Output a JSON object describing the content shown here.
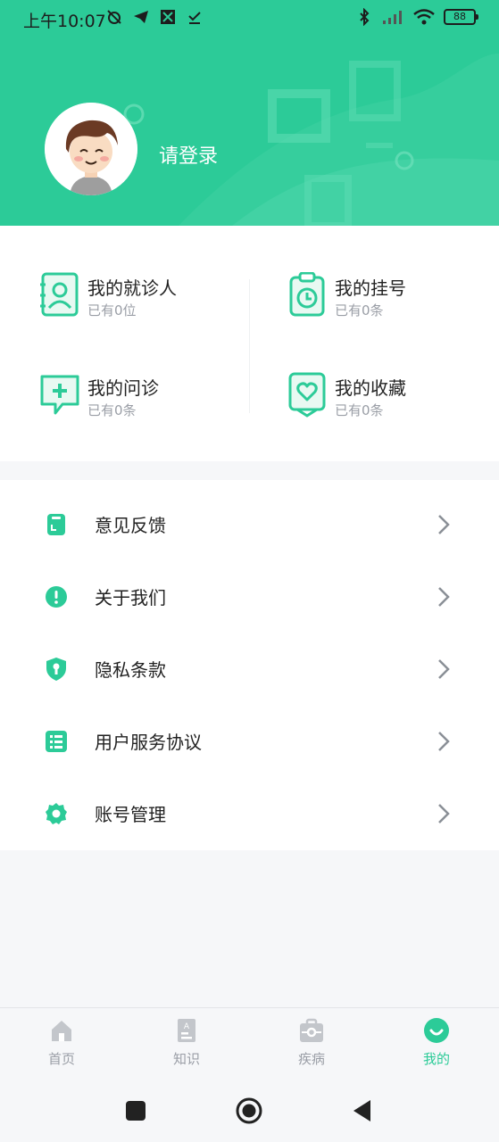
{
  "status_bar": {
    "time": "上午10:07",
    "battery": "88"
  },
  "profile": {
    "login_prompt": "请登录"
  },
  "quick_links": [
    {
      "title": "我的就诊人",
      "subtitle": "已有0位",
      "icon": "contact-card-icon"
    },
    {
      "title": "我的挂号",
      "subtitle": "已有0条",
      "icon": "clipboard-clock-icon"
    },
    {
      "title": "我的问诊",
      "subtitle": "已有0条",
      "icon": "chat-plus-icon"
    },
    {
      "title": "我的收藏",
      "subtitle": "已有0条",
      "icon": "heart-bookmark-icon"
    }
  ],
  "menu": [
    {
      "label": "意见反馈",
      "icon": "feedback-icon"
    },
    {
      "label": "关于我们",
      "icon": "info-icon"
    },
    {
      "label": "隐私条款",
      "icon": "shield-icon"
    },
    {
      "label": "用户服务协议",
      "icon": "agreement-icon"
    },
    {
      "label": "账号管理",
      "icon": "gear-icon"
    }
  ],
  "tabs": [
    {
      "label": "首页",
      "icon": "home-icon",
      "active": false
    },
    {
      "label": "知识",
      "icon": "knowledge-icon",
      "active": false
    },
    {
      "label": "疾病",
      "icon": "medical-kit-icon",
      "active": false
    },
    {
      "label": "我的",
      "icon": "profile-smile-icon",
      "active": true
    }
  ],
  "colors": {
    "accent": "#2ccb98",
    "inactive": "#9a9ea6"
  }
}
